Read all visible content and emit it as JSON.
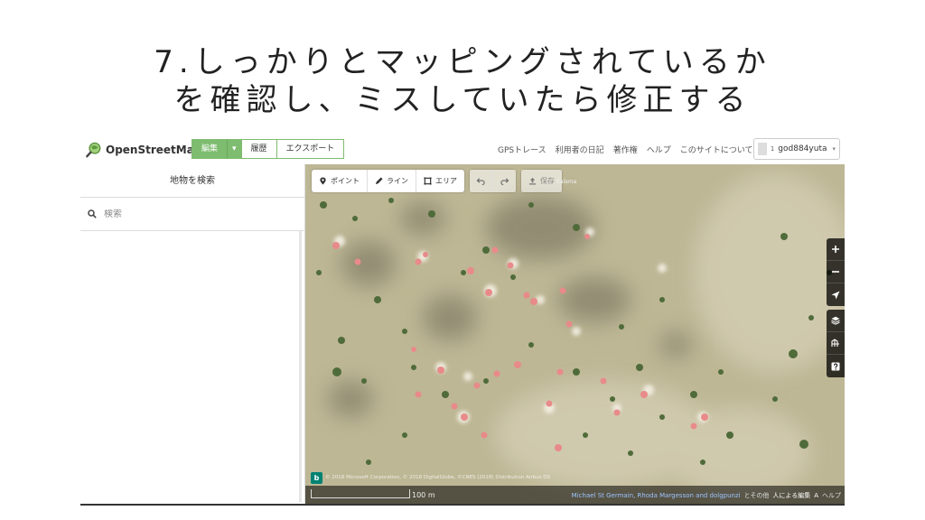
{
  "slide": {
    "title_line1": "7.しっかりとマッピングされているか",
    "title_line2": "を確認し、ミスしていたら修正する"
  },
  "header": {
    "logo_text": "OpenStreetMap",
    "edit_label": "編集",
    "history_label": "履歴",
    "export_label": "エクスポート",
    "nav": [
      "GPSトレース",
      "利用者の日記",
      "著作権",
      "ヘルプ",
      "このサイトについて"
    ],
    "user": {
      "count": "1",
      "name": "god884yuta"
    }
  },
  "sidebar": {
    "title": "地物を検索",
    "search_placeholder": "検索"
  },
  "editor": {
    "point_label": "ポイント",
    "line_label": "ライン",
    "area_label": "エリア",
    "save_label": "保存",
    "location_label": "Kalama"
  },
  "map": {
    "imagery_credit": "© 2018 Microsoft Corporation, © 2018 DigitalGlobe, ©CNES (2018) Distribution Airbus DS",
    "scale_label": "100 m",
    "contributors": "Michael St Germain, Rhoda Margesson and dolgpunzi",
    "contributors_suffix": "とその他",
    "improve_label": "人による編集",
    "language_label": "A",
    "help_label": "ヘルプ"
  },
  "icons": {
    "logo": "magnifier-globe-icon",
    "search": "search-icon",
    "point": "map-pin-icon",
    "line": "pencil-icon",
    "area": "area-square-icon",
    "undo": "undo-icon",
    "redo": "redo-icon",
    "save": "upload-icon",
    "zoom_in": "plus-icon",
    "zoom_out": "minus-icon",
    "geolocate": "location-arrow-icon",
    "layers": "layers-icon",
    "map_data": "map-data-icon",
    "help": "help-icon"
  },
  "colors": {
    "osm_green": "#7ebc6f",
    "feature_pink": "#e98a8a",
    "map_ground": "#b9b491"
  }
}
